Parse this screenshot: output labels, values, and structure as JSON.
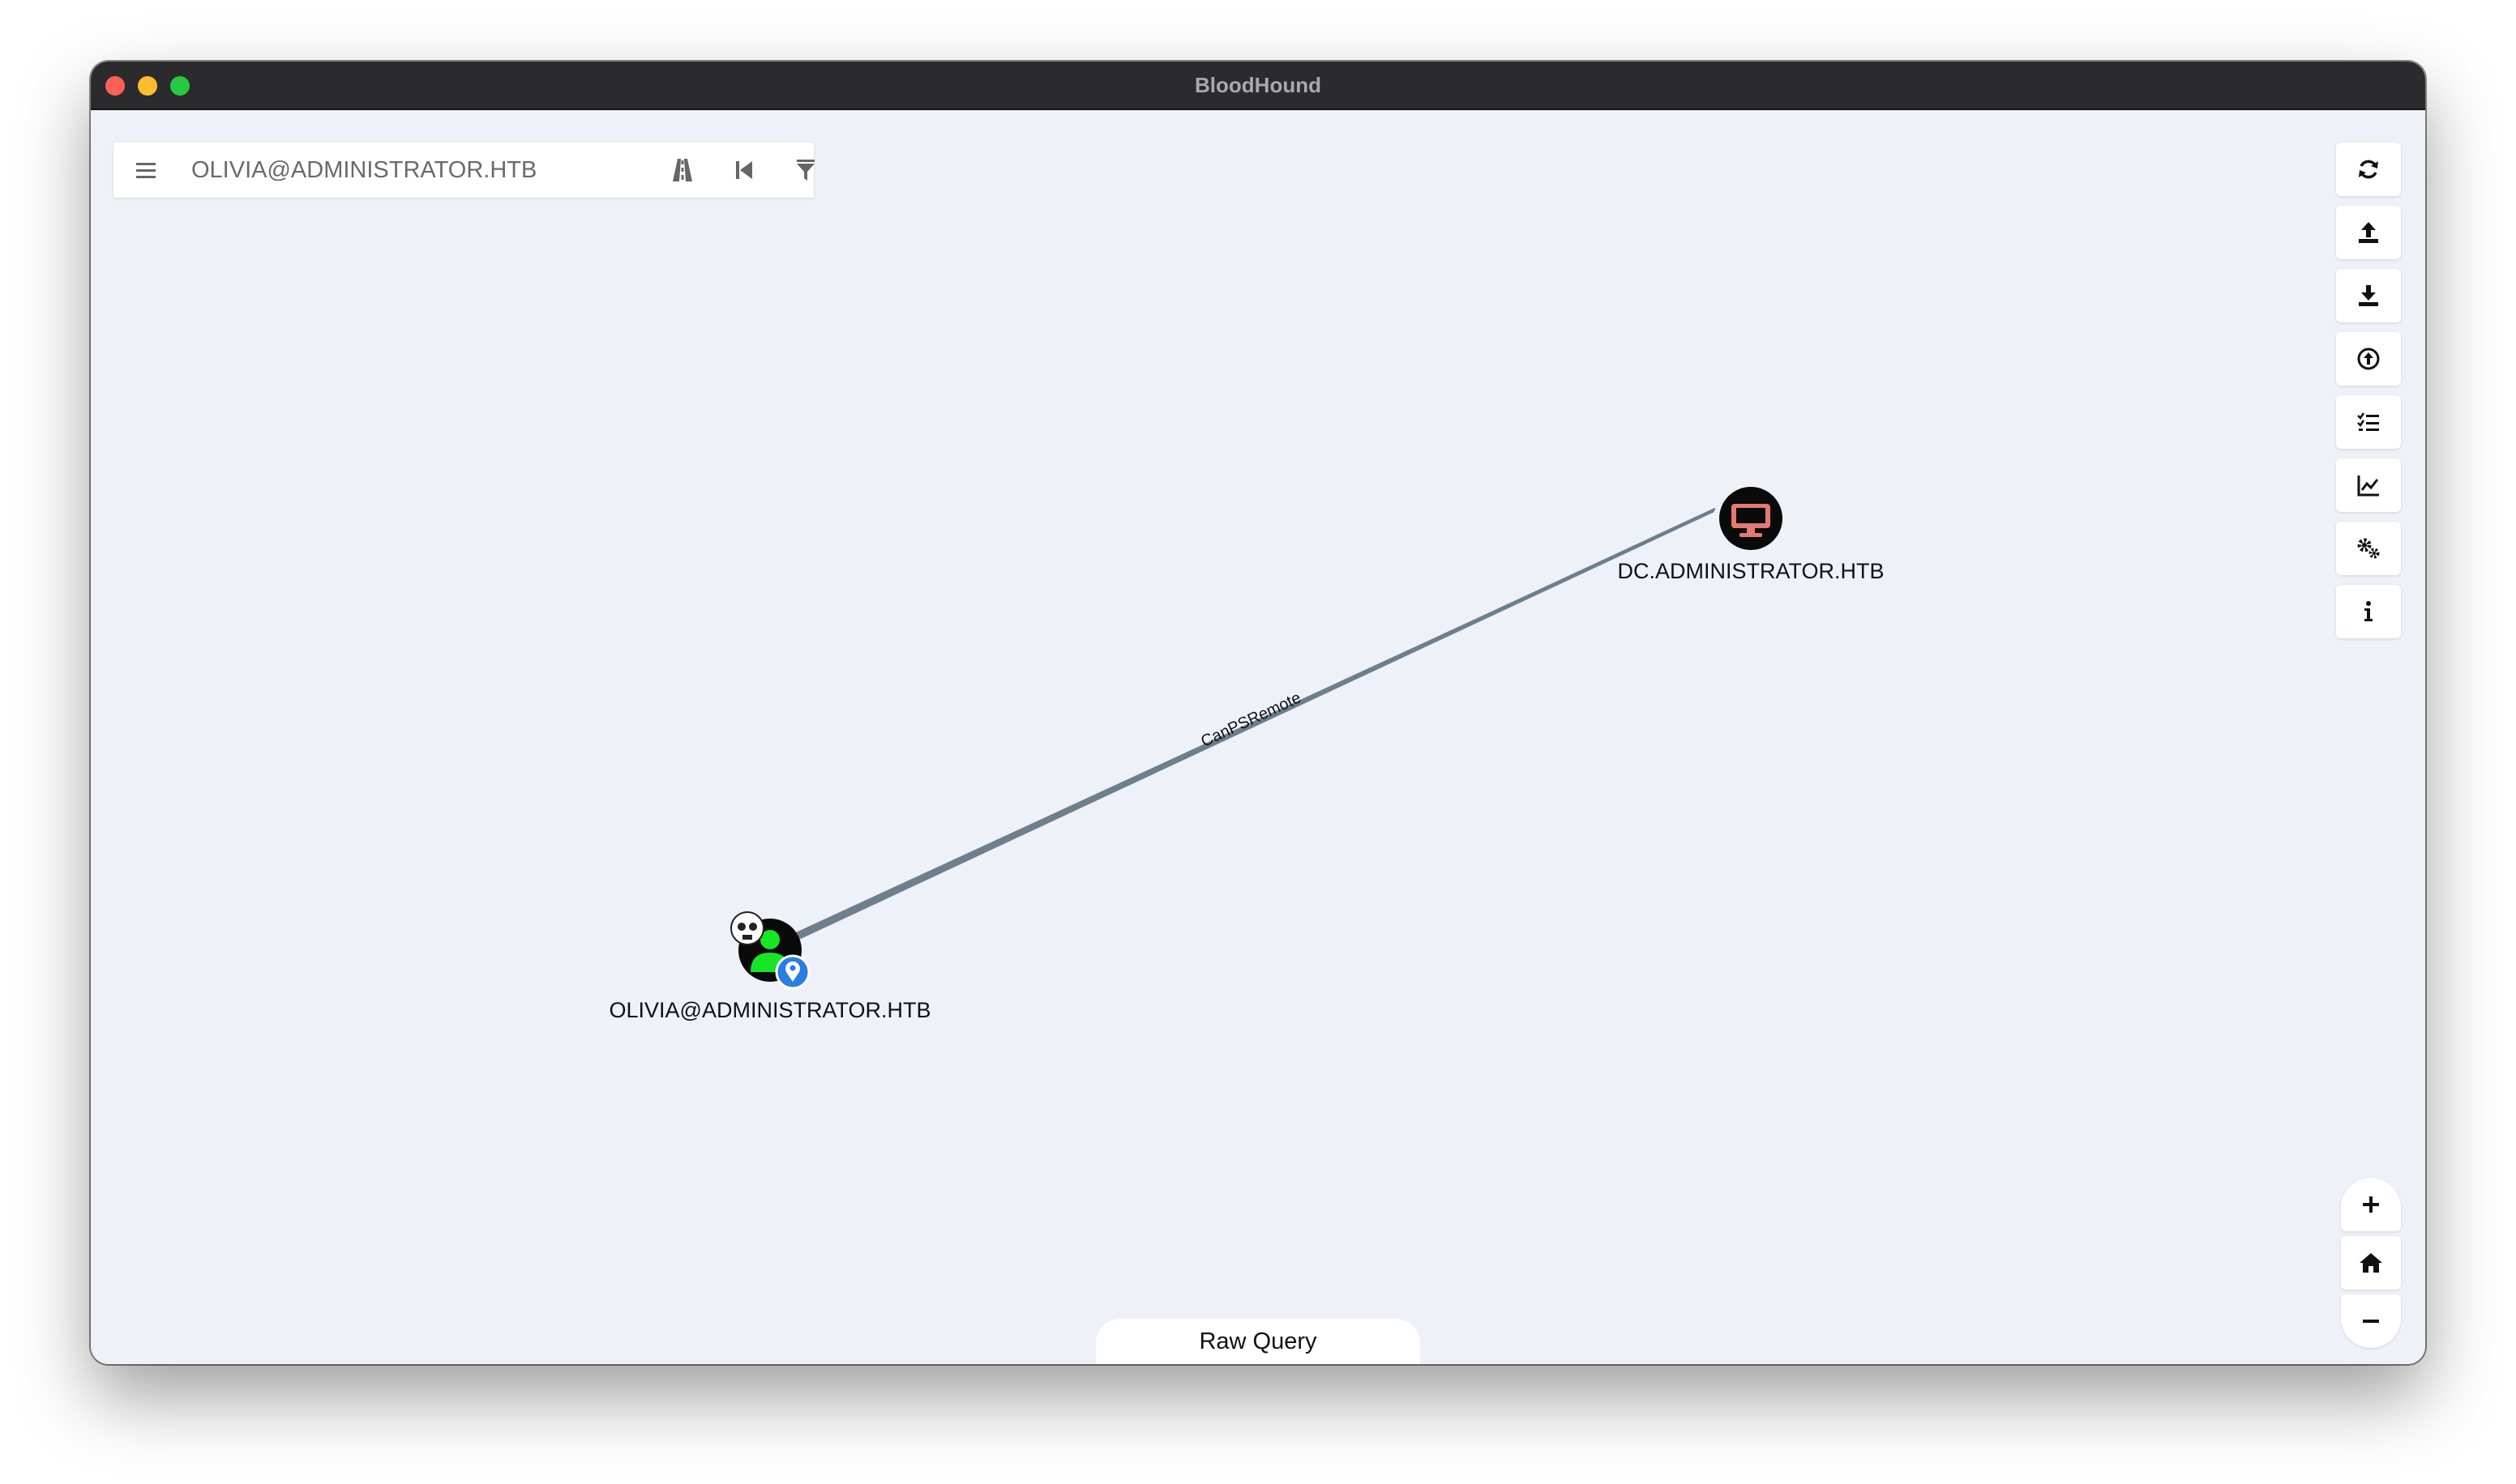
{
  "window": {
    "title": "BloodHound"
  },
  "search": {
    "value": "OLIVIA@ADMINISTRATOR.HTB"
  },
  "toolbar_left": {
    "icons": [
      "menu-icon",
      "pathfinding-icon",
      "back-icon",
      "filter-icon"
    ]
  },
  "toolbar_right": {
    "icons": [
      "refresh-icon",
      "upload-icon",
      "download-icon",
      "import-icon",
      "queries-list-icon",
      "chart-icon",
      "settings-icon",
      "info-icon"
    ]
  },
  "zoom": {
    "icons": [
      "zoom-in-icon",
      "home-icon",
      "zoom-out-icon"
    ]
  },
  "graph": {
    "nodes": [
      {
        "id": "user",
        "label": "OLIVIA@ADMINISTRATOR.HTB",
        "type": "User",
        "badges": [
          "owned-skull-icon",
          "start-node-pin-icon"
        ],
        "color": "#17e625"
      },
      {
        "id": "computer",
        "label": "DC.ADMINISTRATOR.HTB",
        "type": "Computer",
        "color": "#e67873"
      }
    ],
    "edges": [
      {
        "from": "user",
        "to": "computer",
        "label": "CanPSRemote",
        "color": "#6d7e8c"
      }
    ]
  },
  "raw_query": {
    "label": "Raw Query"
  }
}
